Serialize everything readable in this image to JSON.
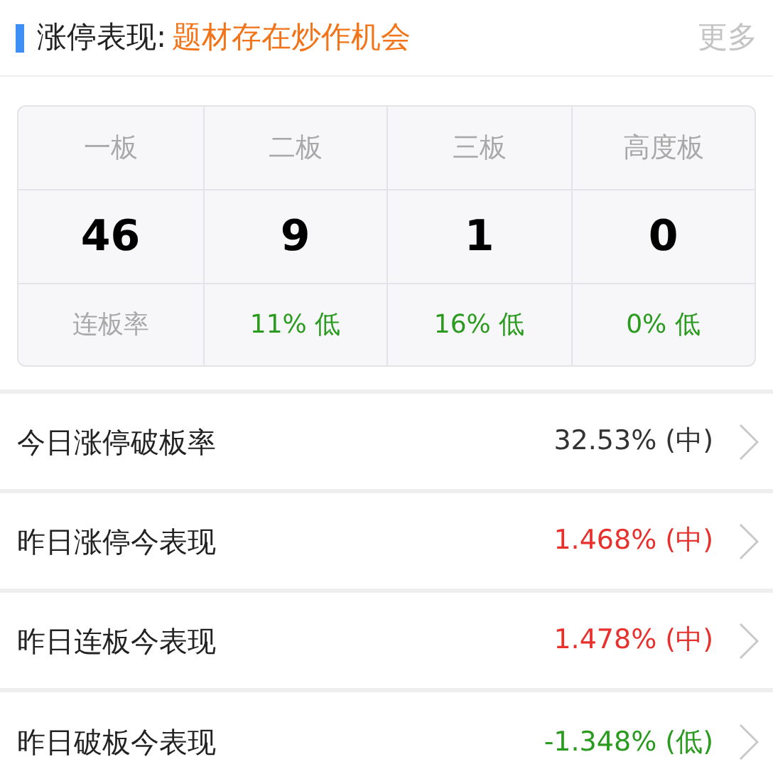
{
  "header": {
    "title": "涨停表现:",
    "highlight": "题材存在炒作机会",
    "more": "更多"
  },
  "board_table": {
    "columns": [
      {
        "label": "一板",
        "count": "46",
        "rate": "连板率",
        "color": "#a8a8a8"
      },
      {
        "label": "二板",
        "count": "9",
        "rate": "11% 低",
        "color": "#2a9b1f"
      },
      {
        "label": "三板",
        "count": "1",
        "rate": "16% 低",
        "color": "#2a9b1f"
      },
      {
        "label": "高度板",
        "count": "0",
        "rate": "0% 低",
        "color": "#2a9b1f"
      }
    ]
  },
  "metrics": [
    {
      "label": "今日涨停破板率",
      "value": "32.53% (中)",
      "color": "#333333"
    },
    {
      "label": "昨日涨停今表现",
      "value": "1.468% (中)",
      "color": "#e8312d"
    },
    {
      "label": "昨日连板今表现",
      "value": "1.478% (中)",
      "color": "#e8312d"
    },
    {
      "label": "昨日破板今表现",
      "value": "-1.348% (低)",
      "color": "#2a9b1f"
    }
  ]
}
